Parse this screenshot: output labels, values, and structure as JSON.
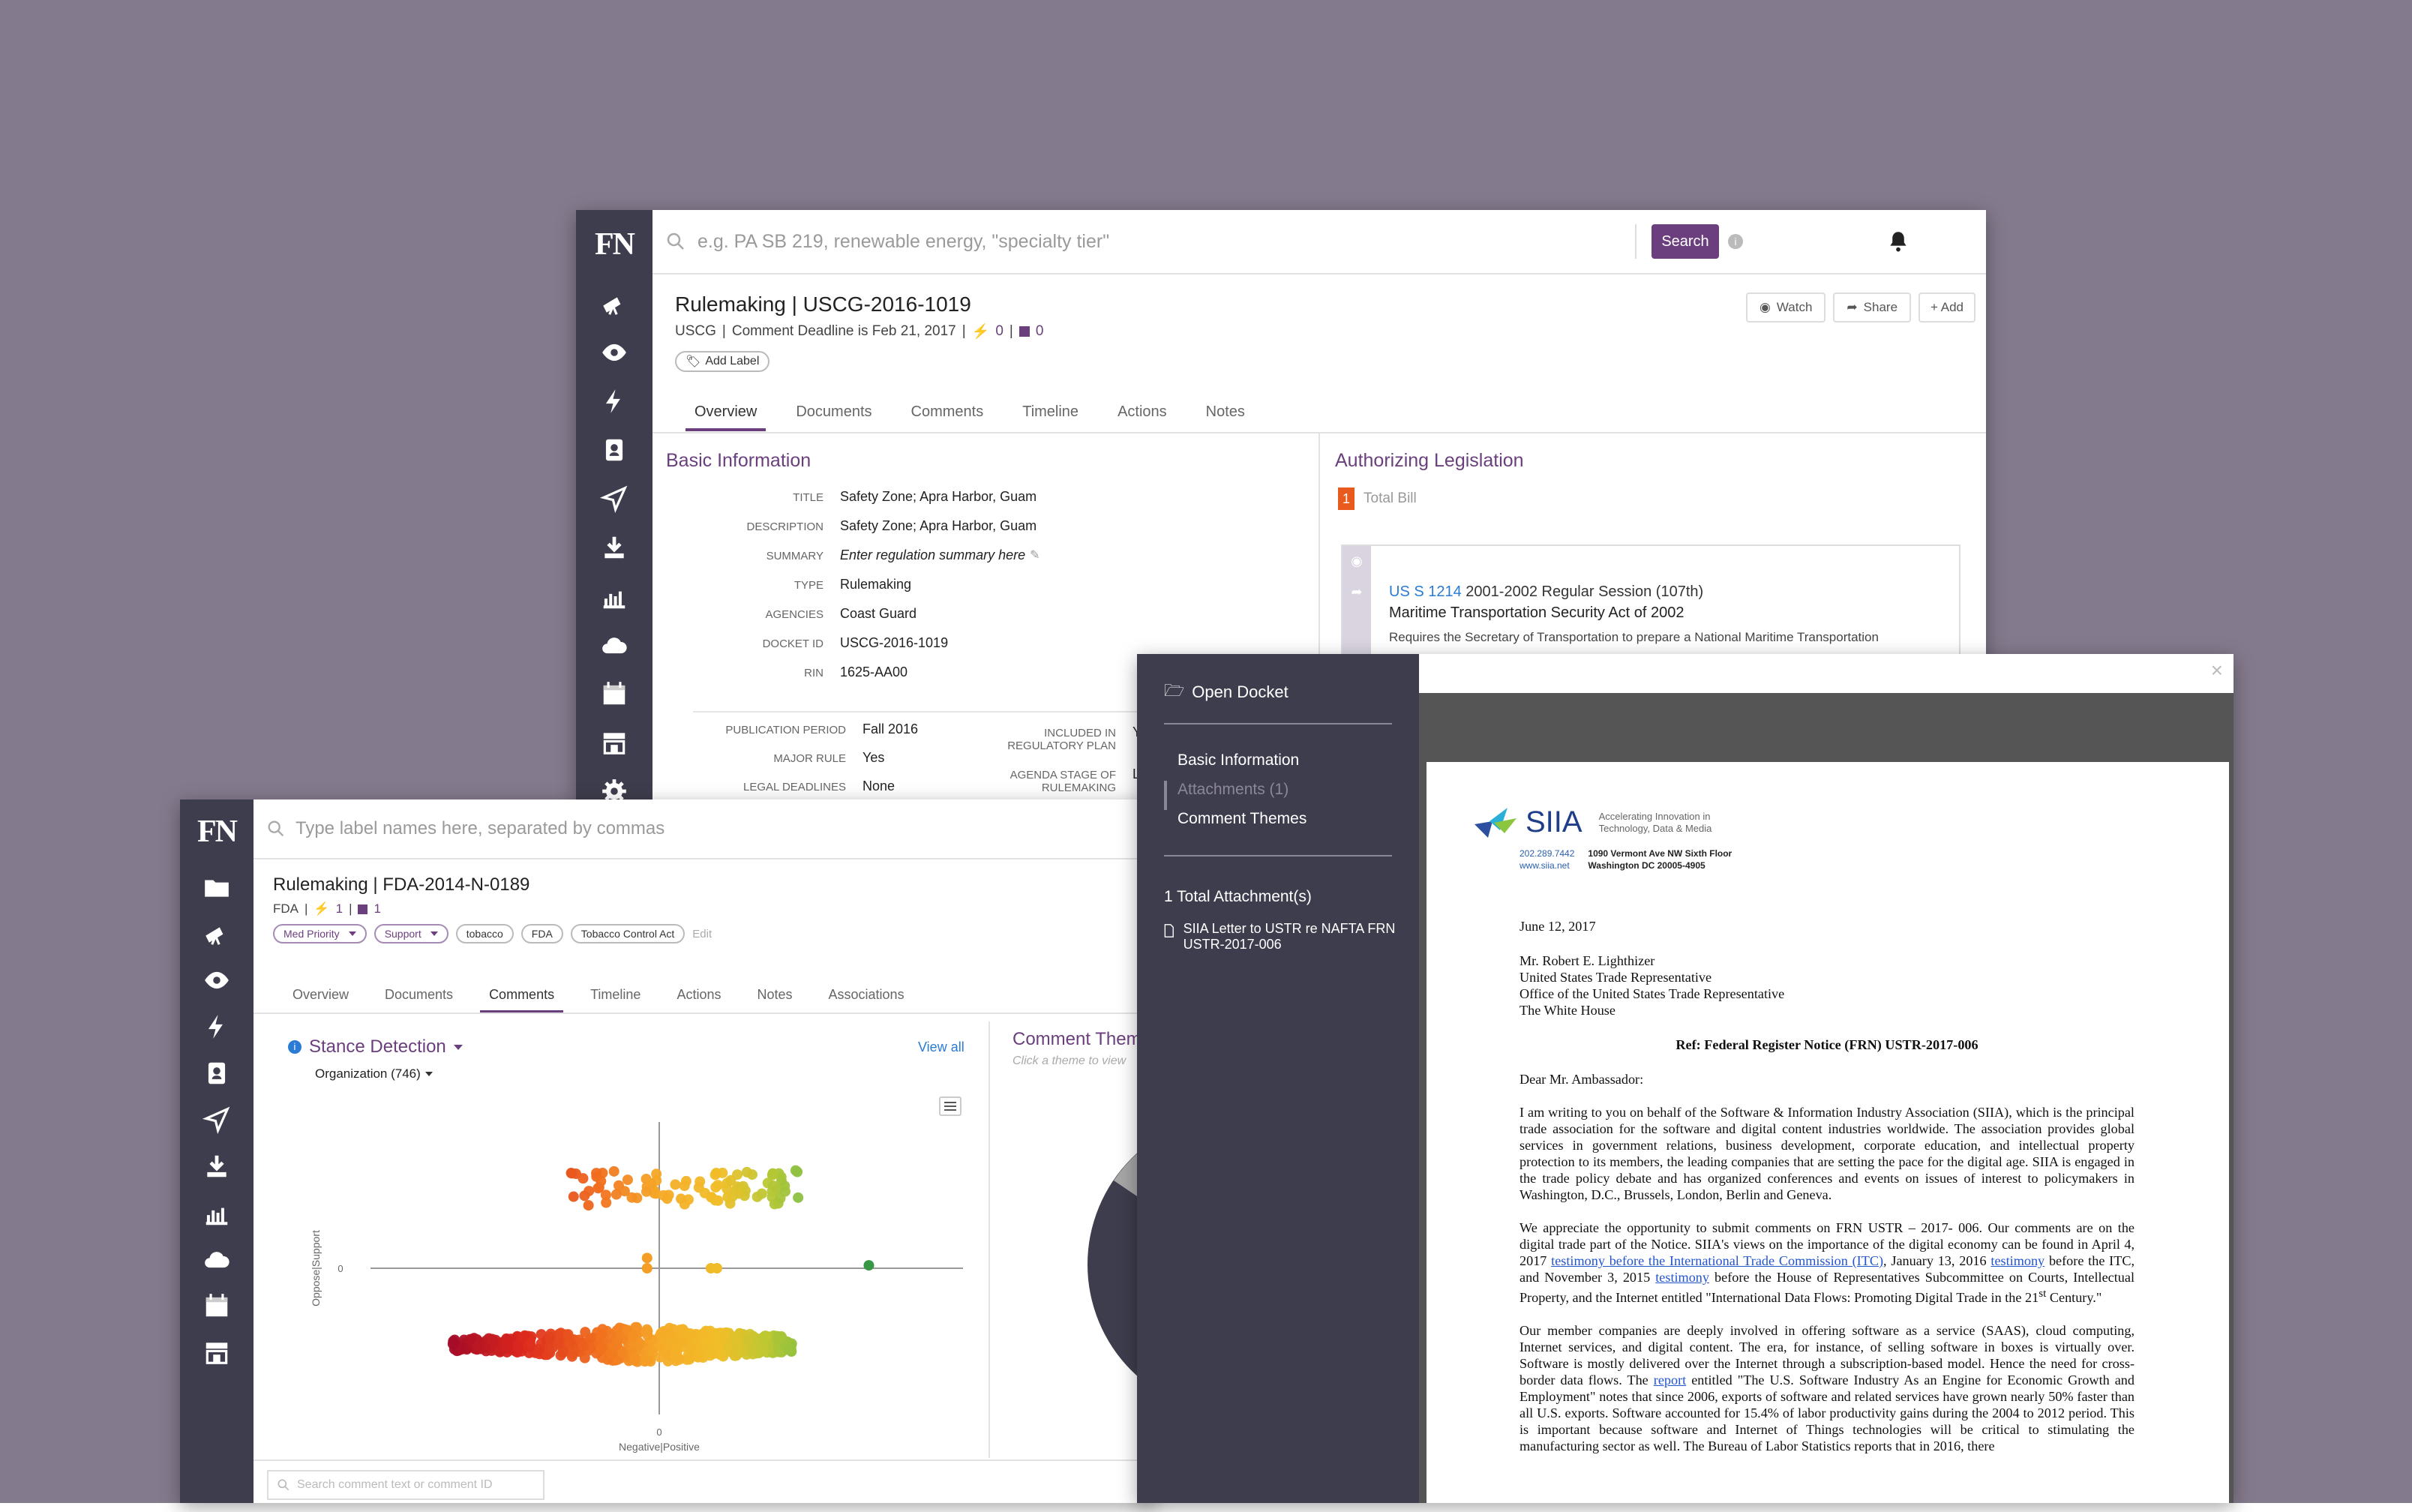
{
  "colors": {
    "background": "#847a8d",
    "sidebar": "#3e3d4d",
    "accent": "#6b3f7e",
    "link": "#2a7bd3",
    "badge": "#e85a1e"
  },
  "win1": {
    "logo": "FN",
    "sidebar_icons": [
      "telescope-icon",
      "eye-icon",
      "bolt-icon",
      "contacts-icon",
      "send-icon",
      "download-icon",
      "bar-chart-icon",
      "cloud-icon",
      "calendar-icon",
      "store-icon",
      "gear-icon"
    ],
    "search_placeholder": "e.g. PA SB 219, renewable energy, \"specialty tier\"",
    "search_button": "Search",
    "title": "Rulemaking | USCG-2016-1019",
    "subtitle_agency": "USCG",
    "subtitle_deadline": "Comment Deadline is Feb 21, 2017",
    "bolt_count": "0",
    "note_count": "0",
    "add_label": "Add Label",
    "watch": "Watch",
    "share": "Share",
    "add": "+ Add",
    "tabs": [
      "Overview",
      "Documents",
      "Comments",
      "Timeline",
      "Actions",
      "Notes"
    ],
    "active_tab": "Overview",
    "basic_info_title": "Basic Information",
    "fields": [
      {
        "label": "TITLE",
        "value": "Safety Zone; Apra Harbor, Guam"
      },
      {
        "label": "DESCRIPTION",
        "value": "Safety Zone; Apra Harbor, Guam"
      },
      {
        "label": "SUMMARY",
        "value": "Enter regulation summary here"
      },
      {
        "label": "TYPE",
        "value": "Rulemaking"
      },
      {
        "label": "AGENCIES",
        "value": "Coast Guard"
      },
      {
        "label": "DOCKET ID",
        "value": "USCG-2016-1019"
      },
      {
        "label": "RIN",
        "value": "1625-AA00"
      }
    ],
    "fields2": [
      {
        "label": "PUBLICATION PERIOD",
        "value": "Fall 2016"
      },
      {
        "label": "MAJOR RULE",
        "value": "Yes"
      },
      {
        "label": "LEGAL DEADLINES",
        "value": "None"
      }
    ],
    "fields3": [
      {
        "label": "INCLUDED IN REGULATORY PLAN",
        "value": "Ye"
      },
      {
        "label": "AGENDA STAGE OF RULEMAKING",
        "value": "Lo"
      }
    ],
    "auth_title": "Authorizing Legislation",
    "total_bill_count": "1",
    "total_bill_label": "Total Bill",
    "bill_id": "US S 1214",
    "bill_session": "2001-2002 Regular Session (107th)",
    "bill_name": "Maritime Transportation Security Act of 2002",
    "bill_desc": "Requires the Secretary of Transportation to prepare a National Maritime Transportation"
  },
  "win2": {
    "logo": "FN",
    "sidebar_icons": [
      "folder-icon",
      "telescope-icon",
      "eye-icon",
      "bolt-icon",
      "contacts-icon",
      "send-icon",
      "download-icon",
      "bar-chart-icon",
      "cloud-icon",
      "calendar-icon",
      "store-icon"
    ],
    "search_placeholder": "Type label names here, separated by commas",
    "title": "Rulemaking | FDA-2014-N-0189",
    "subtitle_agency": "FDA",
    "bolt_count": "1",
    "note_count": "1",
    "labels": [
      {
        "text": "Med Priority",
        "dropdown": true,
        "purple": true
      },
      {
        "text": "Support",
        "dropdown": true,
        "purple": true
      },
      {
        "text": "tobacco",
        "dropdown": false,
        "purple": false
      },
      {
        "text": "FDA",
        "dropdown": false,
        "purple": false
      },
      {
        "text": "Tobacco Control Act",
        "dropdown": false,
        "purple": false
      }
    ],
    "edit": "Edit",
    "tabs": [
      "Overview",
      "Documents",
      "Comments",
      "Timeline",
      "Actions",
      "Notes",
      "Associations"
    ],
    "active_tab": "Comments",
    "stance_title": "Stance Detection",
    "view_all": "View all",
    "organization": "Organization (746)",
    "themes_title": "Comment Themes",
    "themes_hint": "Click a theme to view",
    "comment_search_placeholder": "Search comment text or comment ID"
  },
  "chart_data": {
    "type": "scatter",
    "title": "Stance Detection",
    "xlabel": "Negative|Positive",
    "ylabel": "Oppose|Support",
    "xticks": [
      "0"
    ],
    "yticks": [
      "0"
    ],
    "xlim": [
      -1,
      1
    ],
    "ylim": [
      -1,
      1
    ],
    "grid": false,
    "legend": "none",
    "clusters": [
      {
        "name": "support",
        "y": 0.55,
        "spread_y": 0.12,
        "x_min": -0.29,
        "x_max": 0.46,
        "count": 90
      },
      {
        "name": "neutral",
        "y": 0.02,
        "spread_y": 0.0,
        "points": [
          [
            -0.04,
            0.07
          ],
          [
            -0.04,
            0.0
          ],
          [
            0.17,
            0.0
          ],
          [
            0.19,
            0.0
          ],
          [
            0.69,
            0.02
          ]
        ]
      },
      {
        "name": "oppose",
        "y": -0.52,
        "spread_y": 0.12,
        "x_min": -0.68,
        "x_max": 0.44,
        "count": 560
      }
    ]
  },
  "doc_panel": {
    "open_docket": "Open Docket",
    "nav": [
      "Basic Information",
      "Attachments (1)",
      "Comment Themes"
    ],
    "active_nav": "Attachments (1)",
    "total": "1 Total Attachment(s)",
    "file_name": "SIIA Letter to USTR re NAFTA FRN USTR-2017-006",
    "close": "×"
  },
  "letter": {
    "logo_text": "SIIA",
    "tagline": "Accelerating Innovation in Technology, Data & Media",
    "phone": "202.289.7442",
    "web": "www.siia.net",
    "address1": "1090 Vermont Ave NW Sixth Floor",
    "address2": "Washington DC 20005-4905",
    "date": "June 12, 2017",
    "to": [
      "Mr. Robert E. Lighthizer",
      "United States Trade Representative",
      "Office of the United States Trade Representative",
      "The White House"
    ],
    "ref": "Ref: Federal Register Notice (FRN) USTR-2017-006",
    "salutation": "Dear Mr. Ambassador:",
    "p1": "I am writing to you on behalf of the Software & Information Industry Association (SIIA), which is the principal trade association for the software and digital content industries worldwide. The association provides global services in government relations, business development, corporate education, and intellectual property protection to its members, the leading companies that are setting the pace for the digital age. SIIA is engaged in the trade policy debate and has organized conferences and events on issues of interest to policymakers in Washington, D.C., Brussels, London, Berlin and Geneva.",
    "p2a": "We appreciate the opportunity to submit comments on FRN USTR – 2017- 006. Our comments are on the digital trade part of the Notice. SIIA's views on the importance of the digital economy can be found in April 4, 2017 ",
    "p2_link1": "testimony before the International Trade Commission (ITC)",
    "p2b": ", January 13, 2016 ",
    "p2_link2": "testimony",
    "p2c": " before the ITC, and November 3, 2015 ",
    "p2_link3": "testimony",
    "p2d": " before the House of Representatives Subcommittee on Courts, Intellectual Property, and the Internet entitled \"International Data Flows: Promoting Digital Trade in the 21",
    "p2_sup": "st",
    "p2e": " Century.\"",
    "p3a": "Our member companies are deeply involved in offering software as a service (SAAS), cloud computing, Internet services, and digital content. The era, for instance, of selling software in boxes is virtually over. Software is mostly delivered over the Internet through a subscription-based model. Hence the need for cross-border data flows. The ",
    "p3_link": "report",
    "p3b": " entitled \"The U.S. Software Industry As an Engine for Economic Growth and Employment\" notes that since 2006, exports of software and related services have grown nearly 50% faster than all U.S. exports. Software accounted for 15.4% of labor productivity gains during the 2004 to 2012 period. This is important because software and Internet of Things technologies will be critical to stimulating the manufacturing sector as well. The Bureau of Labor Statistics reports that in 2016, there"
  }
}
